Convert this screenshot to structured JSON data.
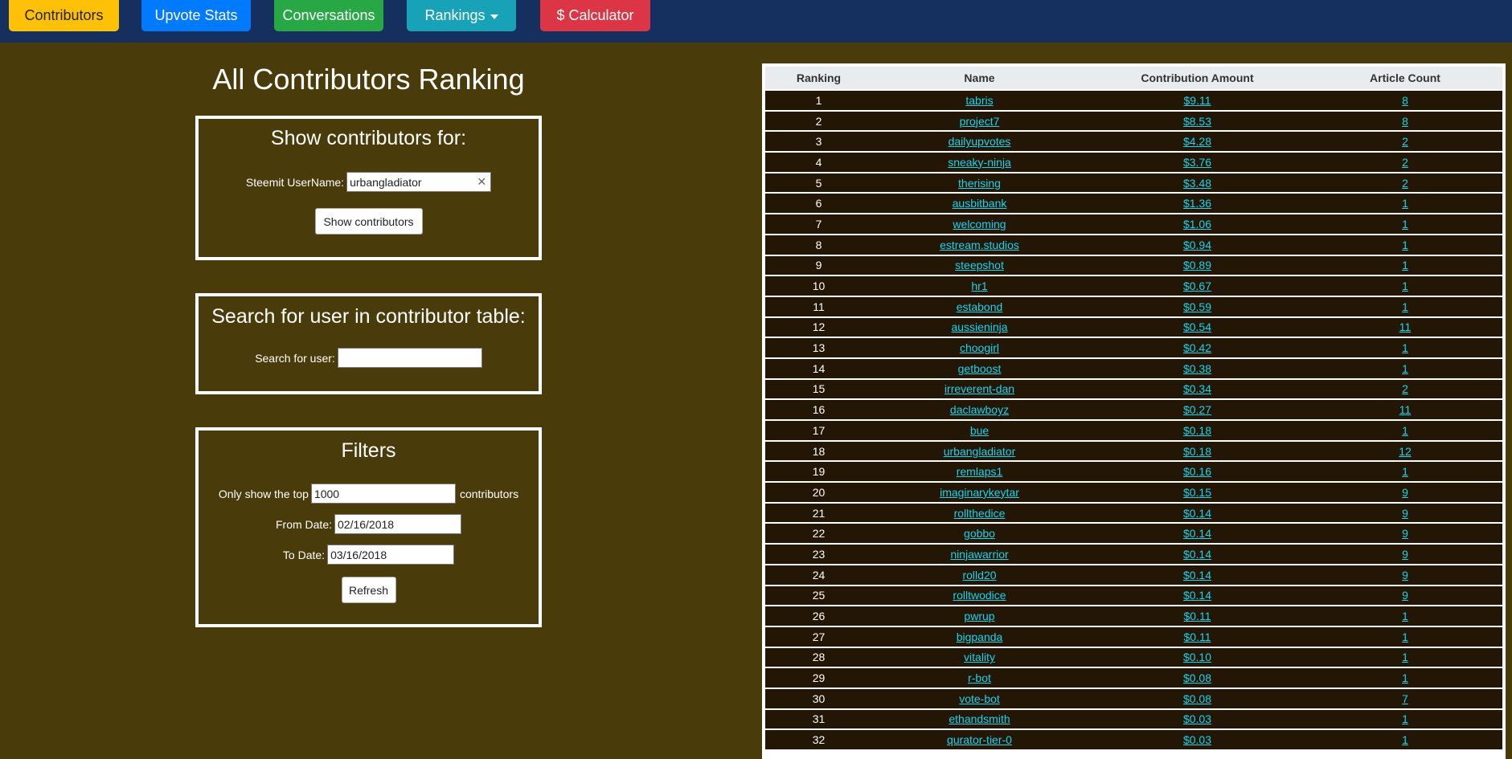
{
  "nav": {
    "contributors": "Contributors",
    "upvote_stats": "Upvote Stats",
    "conversations": "Conversations",
    "rankings": "Rankings",
    "calculator": "$ Calculator"
  },
  "page_title": "All Contributors Ranking",
  "show_panel": {
    "title": "Show contributors for:",
    "username_label": "Steemit UserName:",
    "username_value": "urbangladiator",
    "button": "Show contributors"
  },
  "search_panel": {
    "title": "Search for user in contributor table:",
    "search_label": "Search for user:",
    "search_value": ""
  },
  "filters_panel": {
    "title": "Filters",
    "top_label": "Only show the top",
    "top_value": "1000",
    "top_suffix": "contributors",
    "from_label": "From Date:",
    "from_value": "02/16/2018",
    "to_label": "To Date:",
    "to_value": "03/16/2018",
    "button": "Refresh"
  },
  "table": {
    "headers": [
      "Ranking",
      "Name",
      "Contribution Amount",
      "Article Count"
    ],
    "rows": [
      [
        "1",
        "tabris",
        "$9.11",
        "8"
      ],
      [
        "2",
        "project7",
        "$8.53",
        "8"
      ],
      [
        "3",
        "dailyupvotes",
        "$4.28",
        "2"
      ],
      [
        "4",
        "sneaky-ninja",
        "$3.76",
        "2"
      ],
      [
        "5",
        "therising",
        "$3.48",
        "2"
      ],
      [
        "6",
        "ausbitbank",
        "$1.36",
        "1"
      ],
      [
        "7",
        "welcoming",
        "$1.06",
        "1"
      ],
      [
        "8",
        "estream.studios",
        "$0.94",
        "1"
      ],
      [
        "9",
        "steepshot",
        "$0.89",
        "1"
      ],
      [
        "10",
        "hr1",
        "$0.67",
        "1"
      ],
      [
        "11",
        "estabond",
        "$0.59",
        "1"
      ],
      [
        "12",
        "aussieninja",
        "$0.54",
        "11"
      ],
      [
        "13",
        "choogirl",
        "$0.42",
        "1"
      ],
      [
        "14",
        "getboost",
        "$0.38",
        "1"
      ],
      [
        "15",
        "irreverent-dan",
        "$0.34",
        "2"
      ],
      [
        "16",
        "daclawboyz",
        "$0.27",
        "11"
      ],
      [
        "17",
        "bue",
        "$0.18",
        "1"
      ],
      [
        "18",
        "urbangladiator",
        "$0.18",
        "12"
      ],
      [
        "19",
        "remlaps1",
        "$0.16",
        "1"
      ],
      [
        "20",
        "imaginarykeytar",
        "$0.15",
        "9"
      ],
      [
        "21",
        "rollthedice",
        "$0.14",
        "9"
      ],
      [
        "22",
        "gobbo",
        "$0.14",
        "9"
      ],
      [
        "23",
        "ninjawarrior",
        "$0.14",
        "9"
      ],
      [
        "24",
        "rolld20",
        "$0.14",
        "9"
      ],
      [
        "25",
        "rolltwodice",
        "$0.14",
        "9"
      ],
      [
        "26",
        "pwrup",
        "$0.11",
        "1"
      ],
      [
        "27",
        "bigpanda",
        "$0.11",
        "1"
      ],
      [
        "28",
        "vitality",
        "$0.10",
        "1"
      ],
      [
        "29",
        "r-bot",
        "$0.08",
        "1"
      ],
      [
        "30",
        "vote-bot",
        "$0.08",
        "7"
      ],
      [
        "31",
        "ethandsmith",
        "$0.03",
        "1"
      ],
      [
        "32",
        "qurator-tier-0",
        "$0.03",
        "1"
      ]
    ]
  }
}
